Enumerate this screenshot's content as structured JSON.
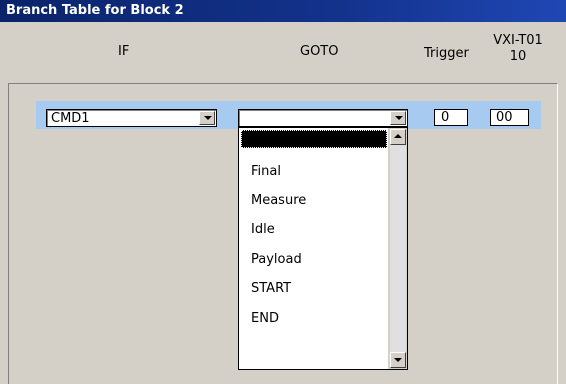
{
  "window": {
    "title": "Branch Table for Block 2"
  },
  "headers": {
    "if": "IF",
    "goto": "GOTO",
    "trigger": "Trigger",
    "vxi_line1": "VXI-T01",
    "vxi_line2": "10"
  },
  "row": {
    "if_value": "CMD1",
    "goto_value": "",
    "trigger_value": "0",
    "vxi_value": "00"
  },
  "goto_options": [
    "Final",
    "Measure",
    "Idle",
    "Payload",
    "START",
    "END"
  ],
  "colors": {
    "title_bar": "#0a246a",
    "row_highlight": "#a6caf0",
    "panel": "#d4d0c8"
  }
}
